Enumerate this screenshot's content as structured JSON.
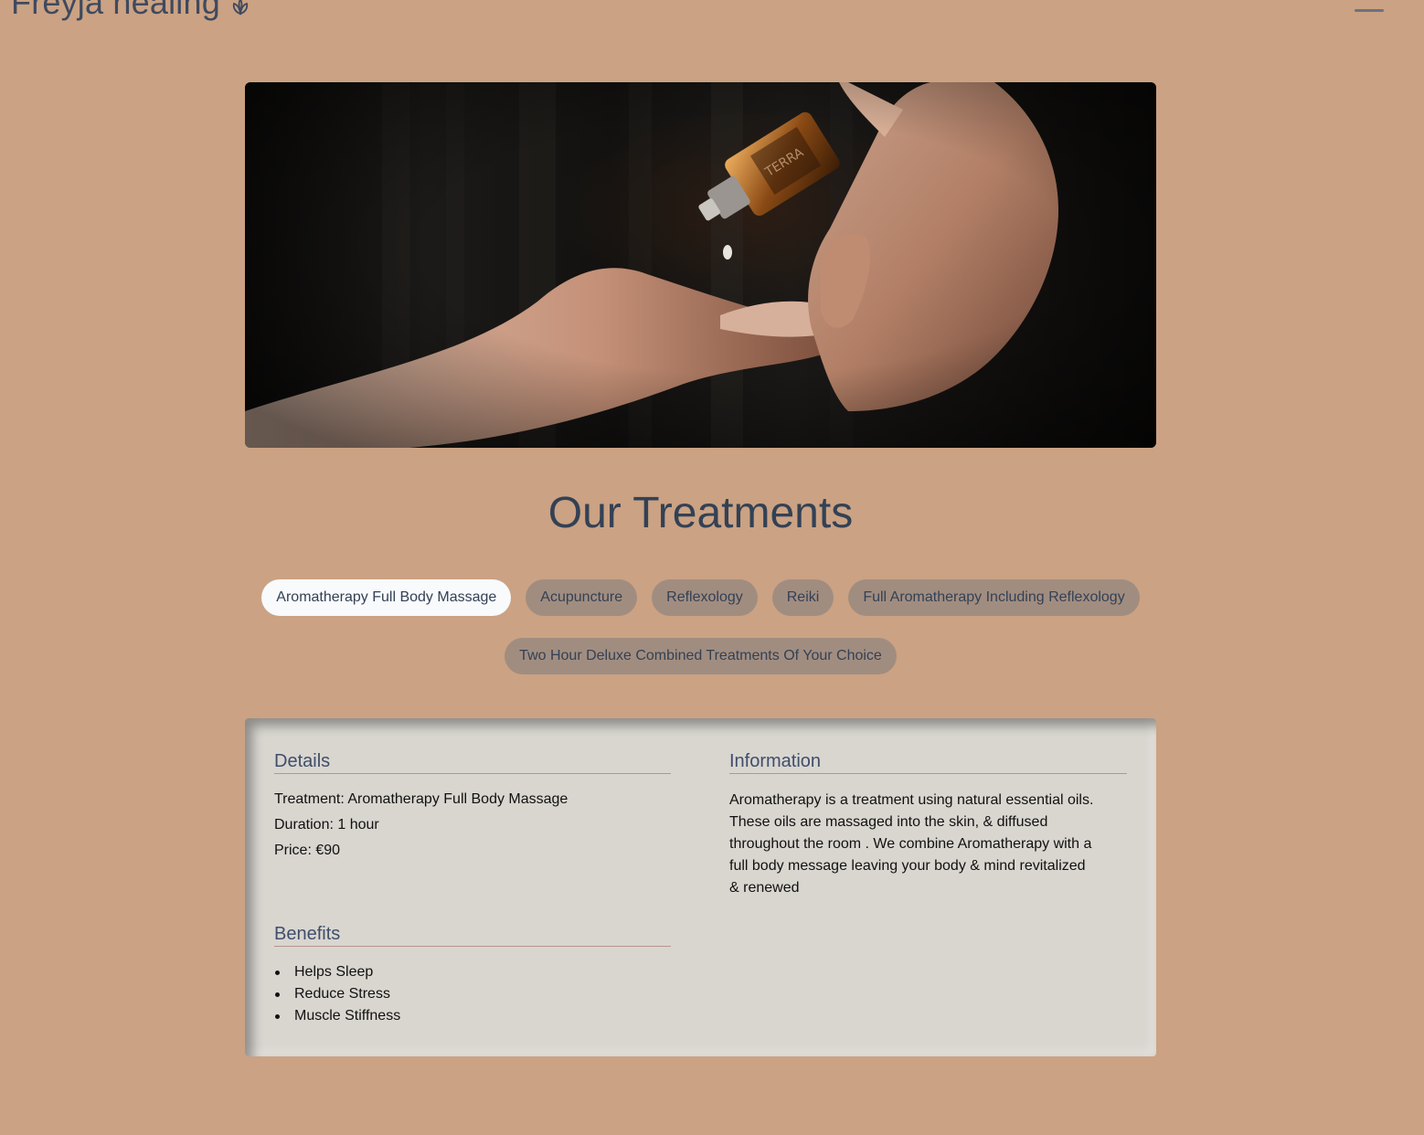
{
  "header": {
    "brand": "Freyja healing",
    "logo_icon": "lotus-leaf-icon",
    "menu_icon": "hamburger-menu-icon"
  },
  "hero": {
    "image_alt": "Hands holding a dropper bottle of essential oil"
  },
  "page_title": "Our Treatments",
  "tabs": [
    {
      "label": "Aromatherapy Full Body Massage",
      "active": true
    },
    {
      "label": "Acupuncture",
      "active": false
    },
    {
      "label": "Reflexology",
      "active": false
    },
    {
      "label": "Reiki",
      "active": false
    },
    {
      "label": "Full Aromatherapy Including Reflexology",
      "active": false
    },
    {
      "label": "Two Hour Deluxe Combined Treatments Of Your Choice",
      "active": false
    }
  ],
  "details": {
    "heading": "Details",
    "treatment": "Treatment: Aromatherapy Full Body Massage",
    "duration": "Duration: 1 hour",
    "price": "Price: €90"
  },
  "information": {
    "heading": "Information",
    "text": "Aromatherapy is a treatment using natural essential oils. These oils are massaged into the skin, & diffused throughout the room . We combine Aromatherapy with a full body message leaving your body & mind revitalized & renewed"
  },
  "benefits": {
    "heading": "Benefits",
    "items": [
      "Helps Sleep",
      "Reduce Stress",
      "Muscle Stiffness"
    ]
  },
  "colors": {
    "background": "#cba283",
    "card": "#d9d6d0",
    "tab_inactive": "#a18d80",
    "tab_active": "#f8fafc",
    "heading": "#334155"
  }
}
